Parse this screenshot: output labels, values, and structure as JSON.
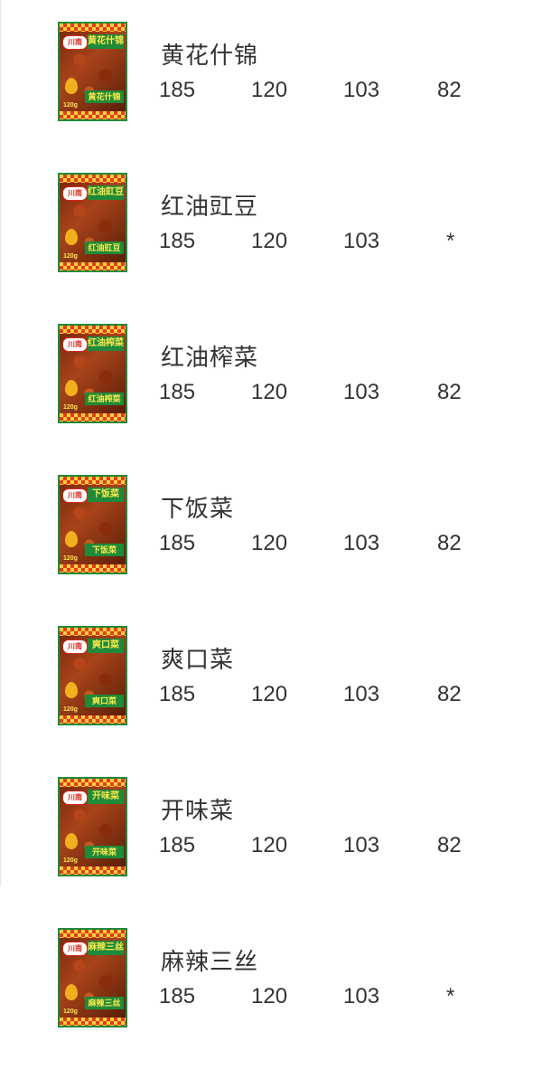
{
  "products": [
    {
      "name": "黄花什锦",
      "thumb_label": "黄花什锦",
      "brand": "川南",
      "weight": "120g",
      "prices": [
        "185",
        "120",
        "103",
        "82"
      ]
    },
    {
      "name": "红油豇豆",
      "thumb_label": "红油豇豆",
      "brand": "川南",
      "weight": "120g",
      "prices": [
        "185",
        "120",
        "103",
        "*"
      ]
    },
    {
      "name": "红油榨菜",
      "thumb_label": "红油榨菜",
      "brand": "川南",
      "weight": "120g",
      "prices": [
        "185",
        "120",
        "103",
        "82"
      ]
    },
    {
      "name": "下饭菜",
      "thumb_label": "下饭菜",
      "brand": "川南",
      "weight": "120g",
      "prices": [
        "185",
        "120",
        "103",
        "82"
      ]
    },
    {
      "name": "爽口菜",
      "thumb_label": "爽口菜",
      "brand": "川南",
      "weight": "120g",
      "prices": [
        "185",
        "120",
        "103",
        "82"
      ]
    },
    {
      "name": "开味菜",
      "thumb_label": "开味菜",
      "brand": "川南",
      "weight": "120g",
      "prices": [
        "185",
        "120",
        "103",
        "82"
      ]
    },
    {
      "name": "麻辣三丝",
      "thumb_label": "麻辣三丝",
      "brand": "川南",
      "weight": "120g",
      "prices": [
        "185",
        "120",
        "103",
        "*"
      ]
    }
  ],
  "colors": {
    "text": "#333333",
    "package_green": "#1f8a3a",
    "package_red": "#e53c1e",
    "package_yellow": "#ffe94a"
  }
}
